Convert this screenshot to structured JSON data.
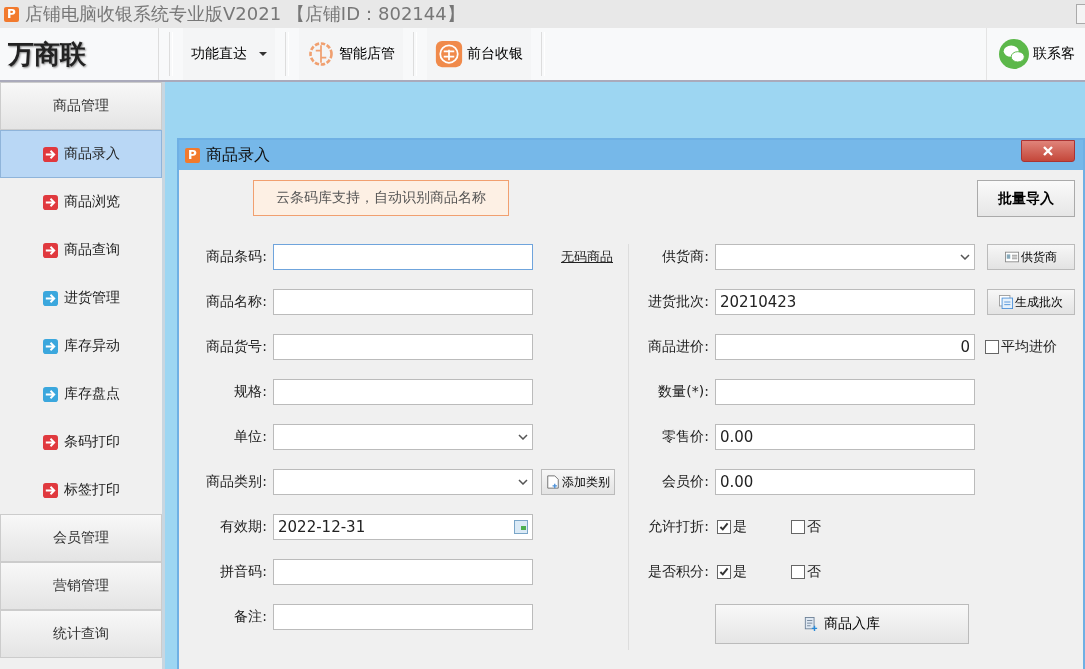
{
  "window": {
    "icon": "P",
    "title": "店铺电脑收银系统专业版V2021 【店铺ID：802144】"
  },
  "toolbar": {
    "logo": "万商联",
    "items": [
      {
        "label": "功能直达",
        "kind": "dropdown"
      },
      {
        "label": "智能店管",
        "kind": "brain"
      },
      {
        "label": "前台收银",
        "kind": "cashier"
      }
    ],
    "contact": "联系客"
  },
  "sidebar": {
    "sections": [
      {
        "label": "商品管理",
        "items": [
          {
            "label": "商品录入",
            "color": "#e0393e",
            "selected": true
          },
          {
            "label": "商品浏览",
            "color": "#e0393e",
            "selected": false
          },
          {
            "label": "商品查询",
            "color": "#e0393e",
            "selected": false
          },
          {
            "label": "进货管理",
            "color": "#3ba7dd",
            "selected": false
          },
          {
            "label": "库存异动",
            "color": "#3ba7dd",
            "selected": false
          },
          {
            "label": "库存盘点",
            "color": "#3ba7dd",
            "selected": false
          },
          {
            "label": "条码打印",
            "color": "#e0393e",
            "selected": false
          },
          {
            "label": "标签打印",
            "color": "#e0393e",
            "selected": false
          }
        ]
      },
      {
        "label": "会员管理"
      },
      {
        "label": "营销管理"
      },
      {
        "label": "统计查询"
      }
    ]
  },
  "dialog": {
    "icon": "P",
    "title": "商品录入",
    "notice": "云条码库支持，自动识别商品名称",
    "batch_import": "批量导入",
    "left_fields": [
      {
        "label": "商品条码:",
        "kind": "text",
        "focused": true,
        "side": {
          "kind": "link",
          "label": "无码商品"
        }
      },
      {
        "label": "商品名称:",
        "kind": "text",
        "focused": false
      },
      {
        "label": "商品货号:",
        "kind": "text",
        "focused": false
      },
      {
        "label": "规格:",
        "kind": "text",
        "focused": false
      },
      {
        "label": "单位:",
        "kind": "select",
        "focused": false
      },
      {
        "label": "商品类别:",
        "kind": "select",
        "focused": false,
        "side": {
          "kind": "add-button",
          "label": "添加类别"
        }
      },
      {
        "label": "有效期:",
        "kind": "date",
        "value": "2022-12-31",
        "focused": false
      },
      {
        "label": "拼音码:",
        "kind": "text",
        "focused": false
      },
      {
        "label": "备注:",
        "kind": "text",
        "focused": false
      }
    ],
    "right_fields": [
      {
        "label": "供货商:",
        "kind": "select",
        "focused": false,
        "side": {
          "kind": "card-button",
          "label": "供货商"
        }
      },
      {
        "label": "进货批次:",
        "kind": "text",
        "value": "20210423",
        "focused": false,
        "side": {
          "kind": "list-button",
          "label": "生成批次"
        }
      },
      {
        "label": "商品进价:",
        "kind": "number",
        "value": "0",
        "focused": false,
        "side": {
          "kind": "checkbox",
          "label": "平均进价",
          "checked": false
        }
      },
      {
        "label": "数量(*):",
        "kind": "text",
        "focused": false
      },
      {
        "label": "零售价:",
        "kind": "text",
        "value": "0.00",
        "focused": false
      },
      {
        "label": "会员价:",
        "kind": "text",
        "value": "0.00",
        "focused": false
      },
      {
        "label": "允许打折:",
        "kind": "options",
        "options": [
          {
            "label": "是",
            "checked": true
          },
          {
            "label": "否",
            "checked": false
          }
        ]
      },
      {
        "label": "是否积分:",
        "kind": "options",
        "options": [
          {
            "label": "是",
            "checked": true
          },
          {
            "label": "否",
            "checked": false
          }
        ]
      }
    ],
    "submit": "商品入库"
  }
}
